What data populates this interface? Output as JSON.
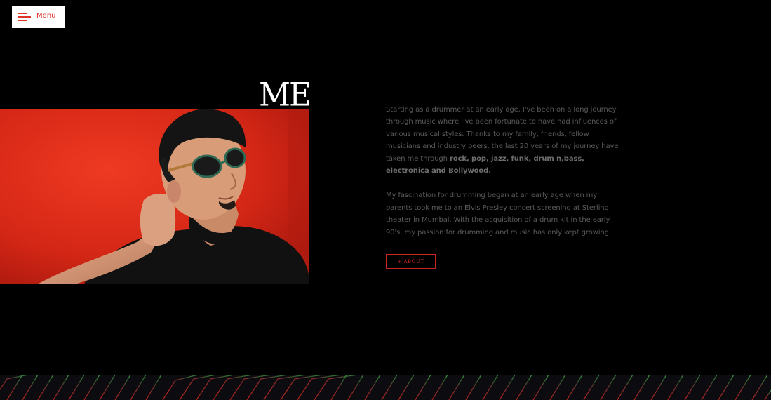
{
  "header": {
    "menu_label": "Menu"
  },
  "about": {
    "heading": "ME",
    "paragraph1_pre": "Starting as a drummer at an early age, I've been on a long journey through music where I've been fortunate to have had influences of various musical styles. Thanks to my family, friends, fellow musicians and industry peers, the last 20 years of my journey have taken me through ",
    "paragraph1_bold": "rock, pop, jazz, funk, drum n,bass, electronica and Bollywood.",
    "paragraph2": "My fascination for drumming began at an early age when my parents took me to an Elvis Presley concert screening at Sterling theater in Mumbai. With the acquisition of a drum kit in the early 90's, my passion for drumming and music has only kept growing.",
    "button_label": "+ ABOUT"
  },
  "colors": {
    "accent": "#e0332a",
    "background": "#000000",
    "photo_background": "#d8281a"
  }
}
